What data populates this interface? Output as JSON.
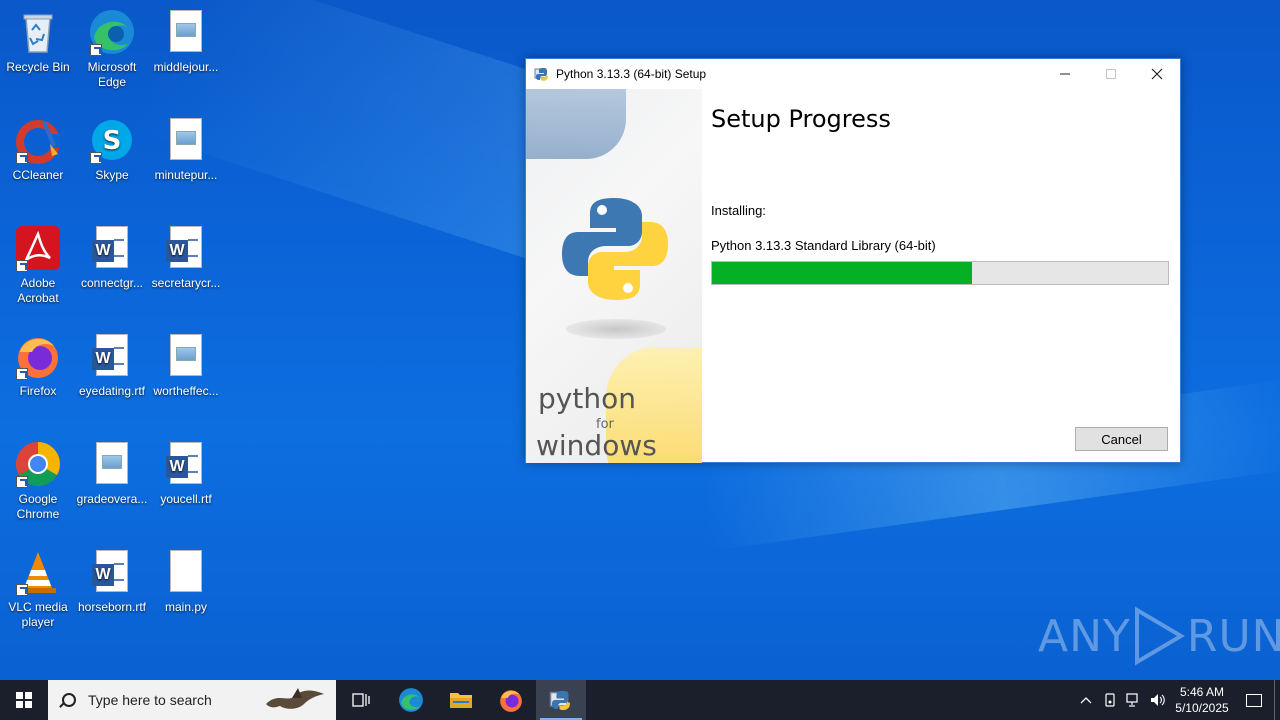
{
  "desktop": {
    "icons": [
      {
        "label": "Recycle Bin"
      },
      {
        "label": "Microsoft Edge"
      },
      {
        "label": "middlejour..."
      },
      {
        "label": "CCleaner"
      },
      {
        "label": "Skype"
      },
      {
        "label": "minutepur..."
      },
      {
        "label": "Adobe Acrobat"
      },
      {
        "label": "connectgr..."
      },
      {
        "label": "secretarycr..."
      },
      {
        "label": "Firefox"
      },
      {
        "label": "eyedating.rtf"
      },
      {
        "label": "wortheffec..."
      },
      {
        "label": "Google Chrome"
      },
      {
        "label": "gradeovera..."
      },
      {
        "label": "youcell.rtf"
      },
      {
        "label": "VLC media player"
      },
      {
        "label": "horseborn.rtf"
      },
      {
        "label": "main.py"
      }
    ]
  },
  "dialog": {
    "title": "Python 3.13.3 (64-bit) Setup",
    "heading": "Setup Progress",
    "installing_label": "Installing:",
    "current_item": "Python 3.13.3 Standard Library (64-bit)",
    "progress_percent": 57,
    "cancel_label": "Cancel",
    "side_text_python": "python",
    "side_text_for": "for",
    "side_text_windows": "windows",
    "progress_color": "#06b025"
  },
  "taskbar": {
    "search_placeholder": "Type here to search",
    "time": "5:46 AM",
    "date": "5/10/2025"
  },
  "watermark": {
    "left": "ANY",
    "right": "RUN"
  }
}
